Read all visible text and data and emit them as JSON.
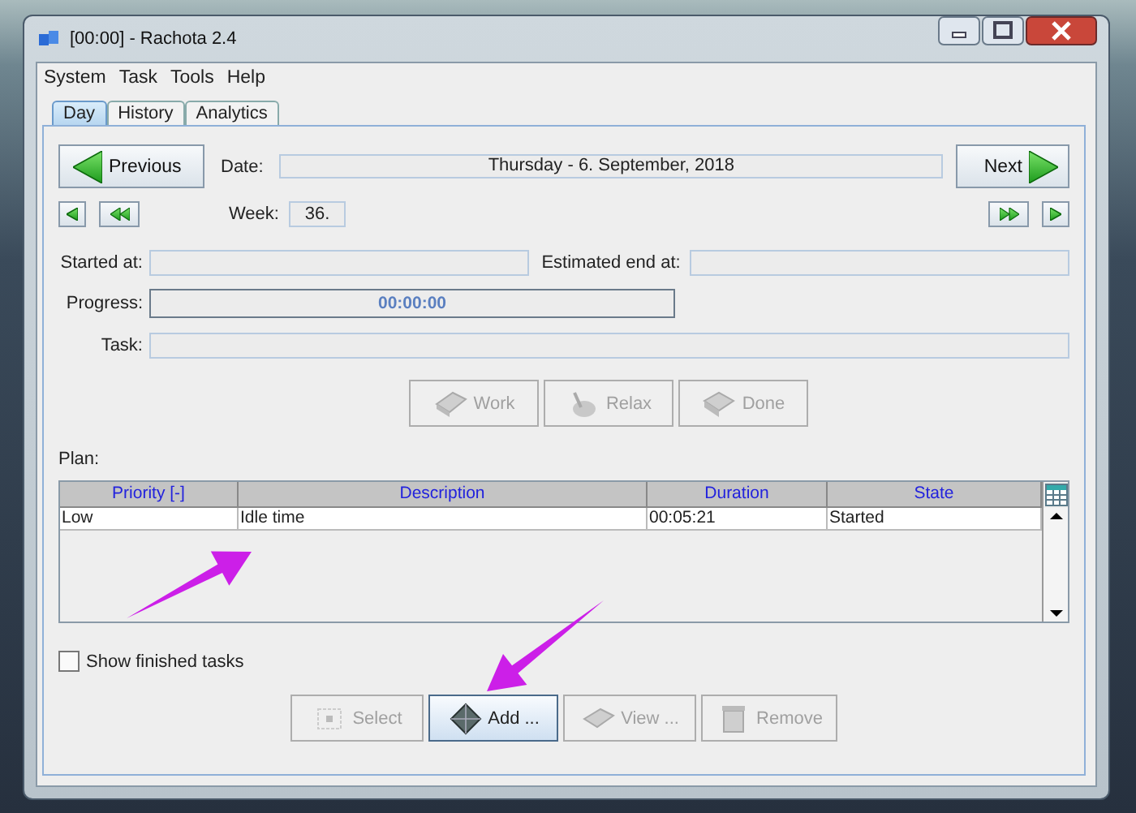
{
  "window": {
    "title": "[00:00] - Rachota 2.4"
  },
  "menu": [
    "System",
    "Task",
    "Tools",
    "Help"
  ],
  "tabs": [
    {
      "label": "Day",
      "selected": true
    },
    {
      "label": "History",
      "selected": false
    },
    {
      "label": "Analytics",
      "selected": false
    }
  ],
  "nav": {
    "previous": "Previous",
    "next": "Next"
  },
  "date": {
    "label": "Date:",
    "value": "Thursday - 6. September, 2018"
  },
  "week": {
    "label": "Week:",
    "value": "36."
  },
  "started_at": {
    "label": "Started at:"
  },
  "estimated_end": {
    "label": "Estimated end at:"
  },
  "progress": {
    "label": "Progress:",
    "value": "00:00:00",
    "level": 0
  },
  "task": {
    "label": "Task:"
  },
  "task_buttons": [
    {
      "kind": "work",
      "label": "Work",
      "disabled": true
    },
    {
      "kind": "relax",
      "label": "Relax",
      "disabled": true
    },
    {
      "kind": "done",
      "label": "Done",
      "disabled": true
    }
  ],
  "plan": {
    "label": "Plan:",
    "columns": [
      "Priority [-]",
      "Description",
      "Duration",
      "State"
    ],
    "rows": [
      [
        "Low",
        "Idle time",
        "00:05:21",
        "Started"
      ]
    ]
  },
  "show_finished": {
    "label": "Show finished tasks",
    "checked": false
  },
  "plan_buttons": [
    {
      "kind": "select",
      "label": "Select",
      "disabled": true
    },
    {
      "kind": "add",
      "label": "Add ...",
      "disabled": false
    },
    {
      "kind": "view",
      "label": "View ...",
      "disabled": true
    },
    {
      "kind": "remove",
      "label": "Remove",
      "disabled": true
    }
  ],
  "annotations": [
    {
      "kind": "arrow"
    },
    {
      "kind": "arrow"
    }
  ]
}
